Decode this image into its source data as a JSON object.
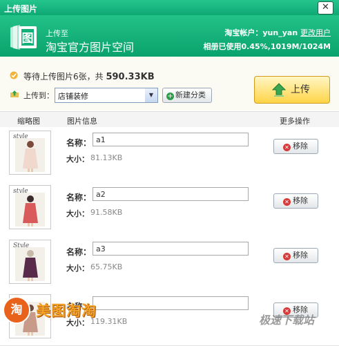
{
  "window": {
    "title": "上传图片",
    "close_glyph": "✕"
  },
  "banner": {
    "subtitle": "上传至",
    "title": "淘宝官方图片空间",
    "account_label": "淘宝帐户：",
    "account_name": "yun_yan",
    "change_user": "更改用户",
    "usage": "相册已使用0.45%,1019M/1024M"
  },
  "actions": {
    "waiting_prefix": "等待上传图片6张，共",
    "waiting_size": "590.33KB",
    "upload_to_label": "上传到：",
    "destination": "店铺装修",
    "new_category": "新建分类",
    "upload_button": "上传"
  },
  "columns": {
    "thumb": "缩略图",
    "info": "图片信息",
    "more": "更多操作"
  },
  "labels": {
    "name": "名称：",
    "size": "大小：",
    "remove": "移除"
  },
  "files": [
    {
      "name": "a1",
      "size": "81.13KB",
      "thumb_word": "style",
      "color": "#f0d8cc",
      "accent": "#7a4a3a"
    },
    {
      "name": "a2",
      "size": "91.58KB",
      "thumb_word": "style",
      "color": "#d85a5a",
      "accent": "#3a2a2a"
    },
    {
      "name": "a3",
      "size": "65.75KB",
      "thumb_word": "Style",
      "color": "#5a2a4a",
      "accent": "#c8b8a8"
    },
    {
      "name": "",
      "size": "119.31KB",
      "thumb_word": "",
      "color": "#c89a8a",
      "accent": "#6a4a3a"
    }
  ],
  "watermarks": {
    "left_badge": "淘",
    "left_text": "美图淘淘",
    "right_text": "极速下载站"
  }
}
